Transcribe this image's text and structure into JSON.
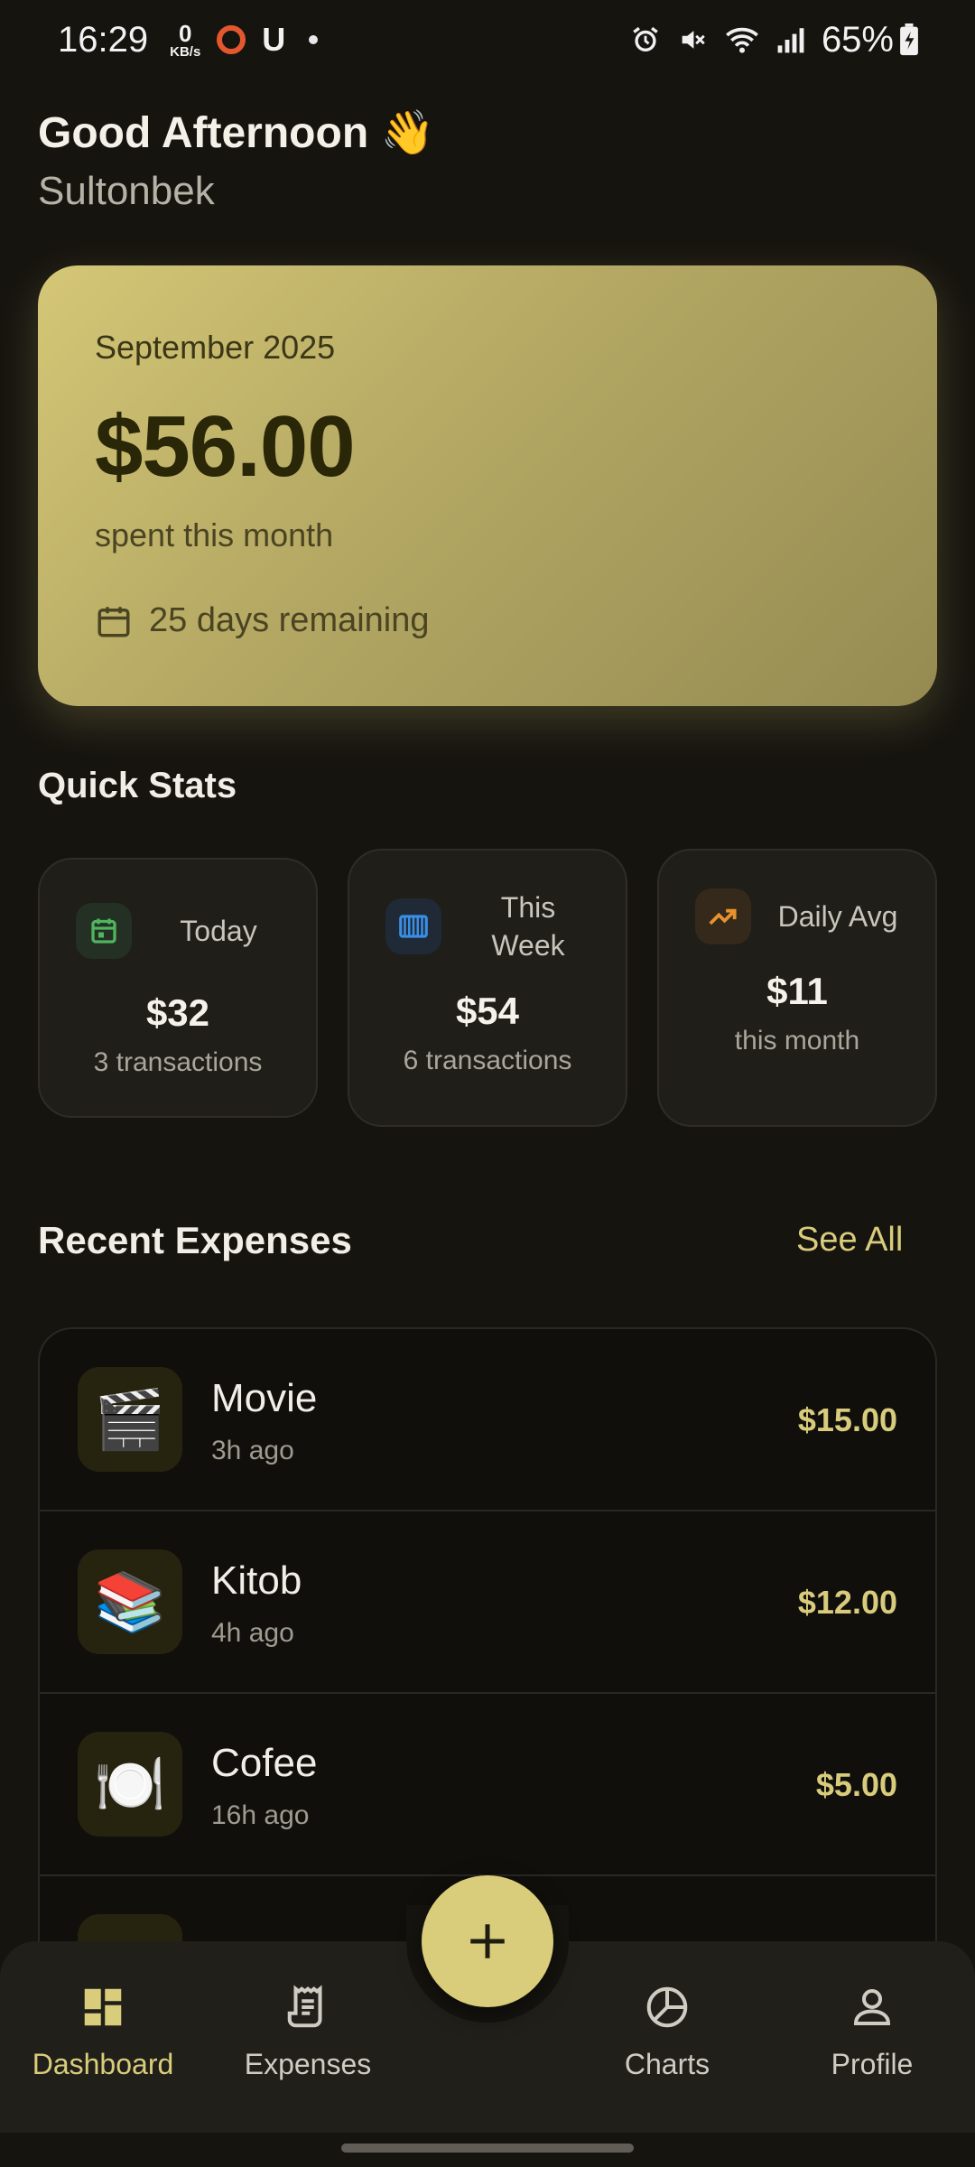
{
  "status_bar": {
    "time": "16:29",
    "net_speed": "0",
    "net_unit": "KB/s",
    "battery": "65%"
  },
  "greeting": {
    "hello": "Good Afternoon",
    "emoji": "👋",
    "name": "Sultonbek"
  },
  "summary": {
    "month": "September 2025",
    "amount": "$56.00",
    "caption": "spent this month",
    "days_remaining": "25 days remaining"
  },
  "quick_stats": {
    "title": "Quick Stats",
    "items": [
      {
        "label": "Today",
        "value": "$32",
        "sub": "3 transactions",
        "icon": "calendar-icon",
        "color": "#4fb55f"
      },
      {
        "label": "This Week",
        "value": "$54",
        "sub": "6 transactions",
        "icon": "view-week-icon",
        "color": "#3a8ee6"
      },
      {
        "label": "Daily Avg",
        "value": "$11",
        "sub": "this month",
        "icon": "trending-up-icon",
        "color": "#e8912f"
      }
    ]
  },
  "recent": {
    "title": "Recent Expenses",
    "see_all": "See All",
    "items": [
      {
        "name": "Movie",
        "time": "3h ago",
        "amount": "$15.00",
        "emoji": "🎬"
      },
      {
        "name": "Kitob",
        "time": "4h ago",
        "amount": "$12.00",
        "emoji": "📚"
      },
      {
        "name": "Cofee",
        "time": "16h ago",
        "amount": "$5.00",
        "emoji": "🍽️"
      }
    ]
  },
  "nav": {
    "items": [
      {
        "label": "Dashboard",
        "icon": "dashboard-icon",
        "active": true
      },
      {
        "label": "Expenses",
        "icon": "receipt-icon",
        "active": false
      },
      {
        "label": "Charts",
        "icon": "pie-chart-icon",
        "active": false
      },
      {
        "label": "Profile",
        "icon": "person-icon",
        "active": false
      }
    ],
    "add_icon": "plus-icon"
  },
  "colors": {
    "background": "#16140f",
    "accent": "#d9cd7b",
    "card": "#1f1e19"
  }
}
